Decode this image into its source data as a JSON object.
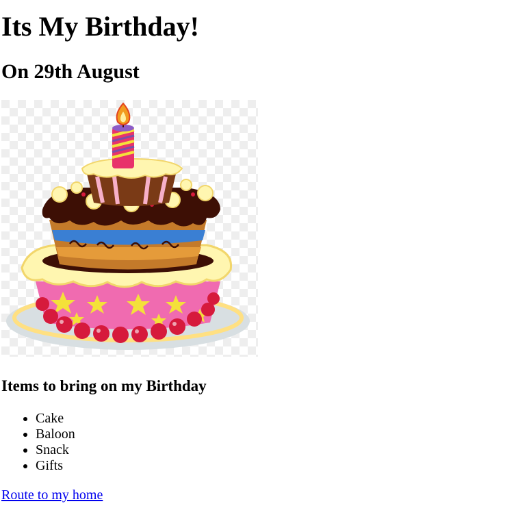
{
  "header": {
    "title": "Its My Birthday!",
    "date": "On 29th August"
  },
  "image": {
    "alt": "birthday-cake",
    "icon": "cake-icon",
    "colors": {
      "candle_flame": "#f29b1e",
      "chocolate": "#3d0f05",
      "frosting": "#fff6b0",
      "blue_layer": "#3a7fd3",
      "pink_base": "#f06bb0",
      "stars": "#f4e13a",
      "cherries": "#d61a3c",
      "plate": "#d8dfe2"
    }
  },
  "items": {
    "heading": "Items to bring on my Birthday",
    "list": [
      "Cake",
      "Baloon",
      "Snack",
      "Gifts"
    ]
  },
  "link": {
    "label": "Route to my home"
  }
}
